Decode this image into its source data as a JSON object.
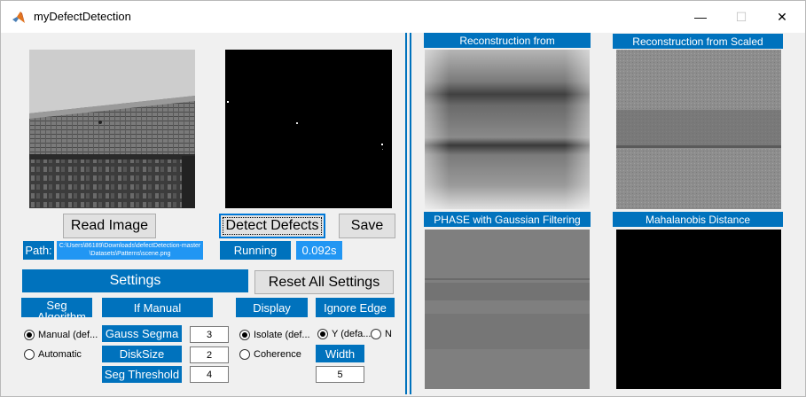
{
  "window": {
    "title": "myDefectDetection",
    "minimize_glyph": "—",
    "maximize_glyph": "☐",
    "close_glyph": "✕",
    "icon": "matlab-icon"
  },
  "left": {
    "read_image_label": "Read Image",
    "detect_defects_label": "Detect Defects",
    "save_label": "Save",
    "path_label": "Path:",
    "path_value": "C:\\Users\\86189\\Downloads\\defectDetection-master\\Datasets\\Patterns\\scene.png",
    "status_text": "Running",
    "time_value": "0.092s",
    "settings_label": "Settings",
    "reset_label": "Reset All Settings",
    "seg_algorithm_label": "Seg Algorithm",
    "if_manual_label": "If Manual",
    "display_label": "Display",
    "ignore_edge_label": "Ignore Edge",
    "seg_options": [
      "Manual (def...",
      "Automatic"
    ],
    "gauss_segma_label": "Gauss Segma",
    "gauss_segma_value": "3",
    "disksize_label": "DiskSize",
    "disksize_value": "2",
    "seg_threshold_label": "Seg Threshold",
    "seg_threshold_value": "4",
    "display_options": [
      "Isolate (def...",
      "Coherence"
    ],
    "ignore_edge_options": [
      "Y (defa...",
      "N"
    ],
    "width_label": "Width",
    "width_value": "5"
  },
  "right": {
    "panel1_title": "Reconstruction from",
    "panel2_title": "Reconstruction from Scaled",
    "panel3_title": "PHASE with Gaussian Filtering",
    "panel4_title": "Mahalanobis Distance"
  },
  "colors": {
    "accent": "#0072bd",
    "accent_light": "#2196f3",
    "background": "#f0f0f0"
  }
}
